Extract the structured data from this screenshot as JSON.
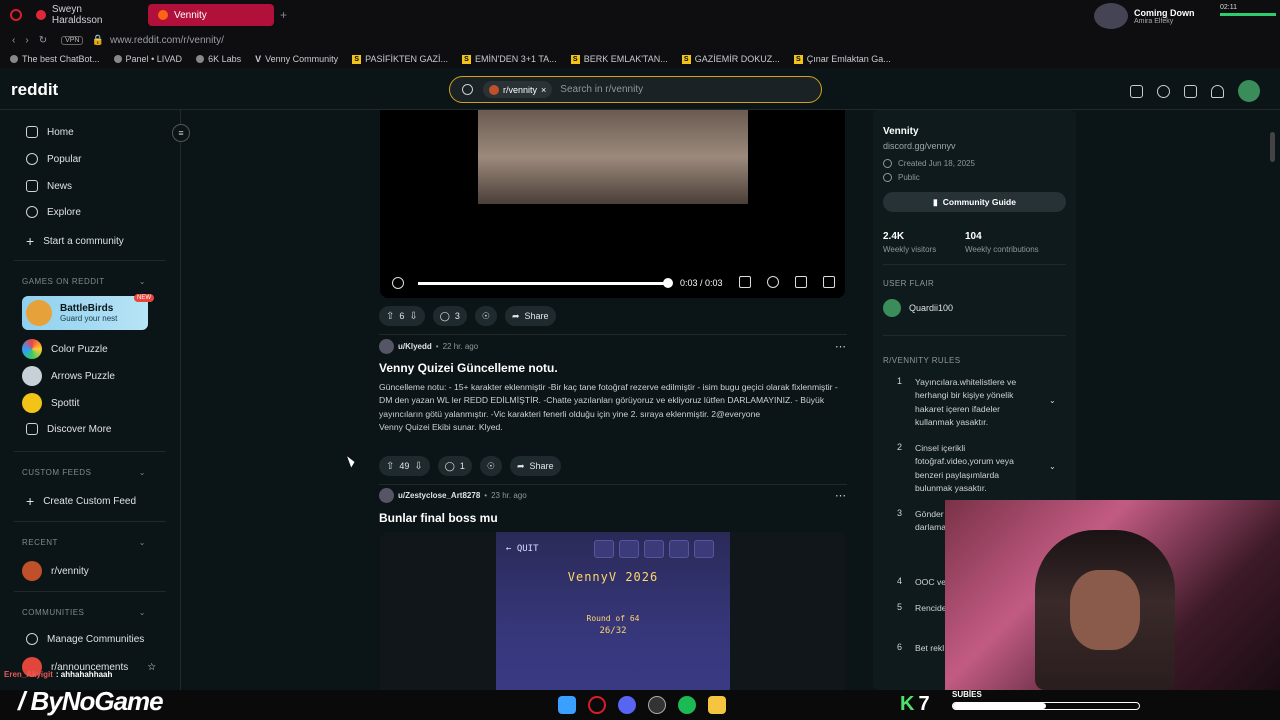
{
  "browser": {
    "tabs": [
      {
        "label": "Sweyn Haraldsson",
        "active": false
      },
      {
        "label": "Vennity",
        "active": true
      }
    ],
    "vpn_label": "VPN",
    "url": "www.reddit.com/r/vennity/",
    "bookmarks": [
      "The best ChatBot...",
      "Panel • LIVAD",
      "6K Labs",
      "Venny Community",
      "PASİFİKTEN GAZİ...",
      "EMİN'DEN 3+1 TA...",
      "BERK EMLAK'TAN...",
      "GAZİEMİR DOKUZ...",
      "Çınar Emlaktan Ga..."
    ],
    "now_playing": {
      "title": "Coming Down",
      "artist": "Amira Elfeky"
    },
    "clock": "02:11"
  },
  "reddit": {
    "logo": "reddit",
    "search": {
      "chip": "r/vennity",
      "placeholder": "Search in r/vennity"
    }
  },
  "sidebar": {
    "nav": [
      "Home",
      "Popular",
      "News",
      "Explore",
      "Start a community"
    ],
    "games_header": "GAMES ON REDDIT",
    "featured_game": {
      "name": "BattleBirds",
      "tagline": "Guard your nest",
      "badge": "NEW"
    },
    "games": [
      "Color Puzzle",
      "Arrows Puzzle",
      "Spottit",
      "Discover More"
    ],
    "custom_feeds_header": "CUSTOM FEEDS",
    "create_custom_feed": "Create Custom Feed",
    "recent_header": "RECENT",
    "recent": [
      "r/vennity"
    ],
    "communities_header": "COMMUNITIES",
    "communities": [
      "Manage Communities",
      "r/announcements"
    ]
  },
  "feed": {
    "video_post": {
      "time": "0:03 / 0:03",
      "votes": "6",
      "comments": "3",
      "share": "Share",
      "progress": 1.0
    },
    "post1": {
      "user": "u/Klyedd",
      "age": "22 hr. ago",
      "title": "Venny Quizei Güncelleme notu.",
      "body": "Güncelleme notu: - 15+ karakter eklenmiştir -Bir kaç tane fotoğraf rezerve edilmiştir - isim bugu geçici olarak fixlenmiştir -DM den yazan WL ler REDD EDİLMİŞTİR. -Chatte yazılanları görüyoruz ve ekliyoruz lütfen DARLAMAYINIZ. - Büyük yayıncıların götü yalanmıştır. -Vic karakteri fenerli olduğu için yine 2. sıraya eklenmiştir. 2@everyone",
      "signature": "Venny Quizei Ekibi sunar. Klyed.",
      "votes": "49",
      "comments": "1",
      "share": "Share"
    },
    "post2": {
      "user": "u/Zestyclose_Art8278",
      "age": "23 hr. ago",
      "title": "Bunlar final boss mu",
      "game": {
        "quit": "QUIT",
        "title": "VennyV 2026",
        "round": "Round of 64",
        "count": "26/32"
      }
    }
  },
  "community": {
    "name": "Vennity",
    "link": "discord.gg/vennyv",
    "created": "Created Jun 18, 2025",
    "visibility": "Public",
    "guide_button": "Community Guide",
    "stats": [
      {
        "value": "2.4K",
        "label": "Weekly visitors"
      },
      {
        "value": "104",
        "label": "Weekly contributions"
      }
    ],
    "user_flair_header": "USER FLAIR",
    "flair_user": "Quardii100",
    "rules_header": "R/VENNITY RULES",
    "rules": [
      {
        "num": "1",
        "text": "Yayıncılara.whitelistlere ve herhangi bir kişiye yönelik hakaret içeren ifadeler kullanmak yasaktır."
      },
      {
        "num": "2",
        "text": "Cinsel içerikli fotoğraf.video,yorum veya benzeri paylaşımlarda bulunmak yasaktır."
      },
      {
        "num": "3",
        "text": "Gönder konuda yok.Bu darlama"
      },
      {
        "num": "4",
        "text": "OOC ve"
      },
      {
        "num": "5",
        "text": "Rencide İçerik Y"
      },
      {
        "num": "6",
        "text": "Bet rekl yasaktır"
      }
    ]
  },
  "overlay": {
    "chat_user": "Eren_Akyigit",
    "chat_msg": ": ahhahahhaah",
    "brand": "ByNoGame",
    "kbadge": "K",
    "kcount": "7",
    "subs_label": "SUBİES",
    "subs_progress": 0.5
  }
}
